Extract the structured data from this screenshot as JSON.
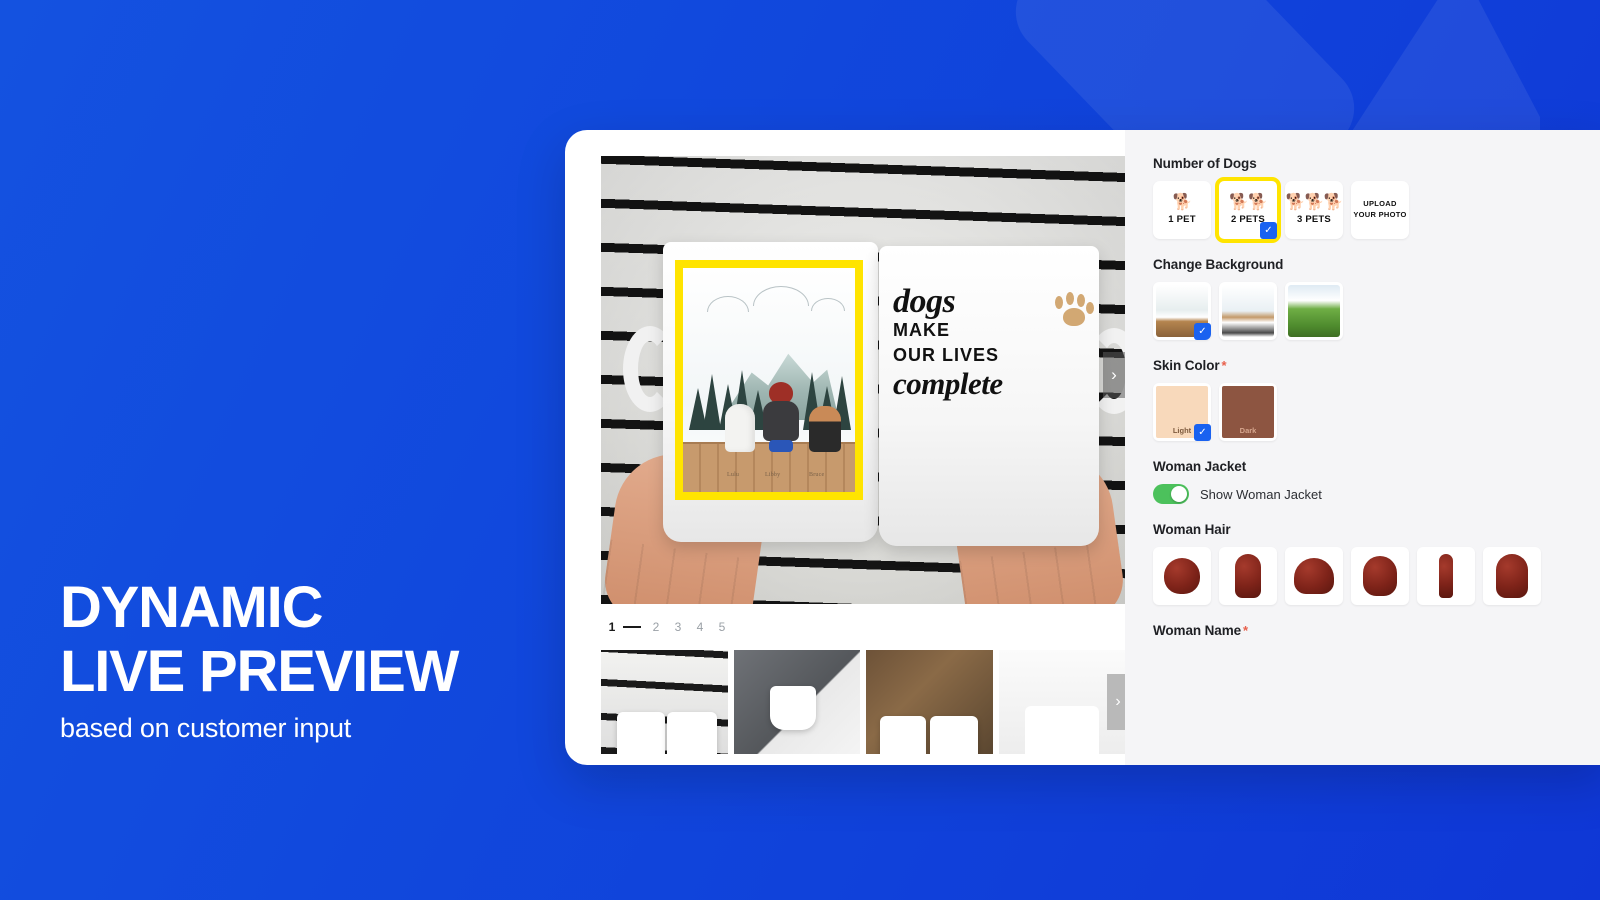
{
  "headline": {
    "line1": "DYNAMIC",
    "line2": "LIVE PREVIEW",
    "subtitle": "based on customer input"
  },
  "theme": {
    "background_blue": "#1149dd",
    "panel_white": "#ffffff",
    "options_bg": "#f5f5f7",
    "selection_yellow": "#ffe400",
    "check_blue": "#1a62f0",
    "toggle_green": "#4CC15C",
    "required_red": "#e8604c"
  },
  "preview": {
    "left_mug": {
      "pet_names": [
        "Lulu",
        "Libby",
        "Bruce"
      ],
      "selected": true
    },
    "right_mug": {
      "quote_line1": "dogs",
      "quote_line2": "MAKE",
      "quote_line3": "OUR  LIVES",
      "quote_line4": "complete"
    },
    "next_arrow": "›",
    "pagination": {
      "pages": [
        "1",
        "2",
        "3",
        "4",
        "5"
      ],
      "active": "1"
    },
    "thumbnails": [
      {
        "name": "thumbnail-1-hands-holding-mugs"
      },
      {
        "name": "thumbnail-2-mug-on-grey-cloth"
      },
      {
        "name": "thumbnail-3-mugs-on-wood"
      },
      {
        "name": "thumbnail-4-single-mug-white"
      }
    ],
    "thumbs_next_arrow": "›"
  },
  "options": {
    "number_of_dogs": {
      "label": "Number of Dogs",
      "required": false,
      "items": [
        {
          "icon": "dog-icon",
          "glyph": "🐕",
          "label": "1 PET",
          "selected": false
        },
        {
          "icon": "two-dogs-icon",
          "glyph": "🐕🐕",
          "label": "2 PETS",
          "selected": true
        },
        {
          "icon": "three-dogs-icon",
          "glyph": "🐕🐕🐕",
          "label": "3 PETS",
          "selected": false
        },
        {
          "icon": "upload-icon",
          "glyph": "",
          "label": "UPLOAD YOUR PHOTO",
          "selected": false
        }
      ]
    },
    "change_background": {
      "label": "Change Background",
      "required": false,
      "items": [
        {
          "name": "background-mountains-forest",
          "selected": true
        },
        {
          "name": "background-lake-pale",
          "selected": false
        },
        {
          "name": "background-green-field",
          "selected": false
        }
      ]
    },
    "skin_color": {
      "label": "Skin Color",
      "required": true,
      "items": [
        {
          "label": "Light",
          "color": "#f8d9bb",
          "selected": true
        },
        {
          "label": "Dark",
          "color": "#8d5541",
          "selected": false
        }
      ]
    },
    "woman_jacket": {
      "label": "Woman Jacket",
      "toggle_label": "Show Woman Jacket",
      "toggle_on": true
    },
    "woman_hair": {
      "label": "Woman Hair",
      "items": [
        {
          "name": "hair-bun",
          "selected": false
        },
        {
          "name": "hair-long-straight",
          "selected": false
        },
        {
          "name": "hair-bob",
          "selected": false
        },
        {
          "name": "hair-wavy-shoulder",
          "selected": false
        },
        {
          "name": "hair-ponytail",
          "selected": false
        },
        {
          "name": "hair-long-curly",
          "selected": false
        }
      ]
    },
    "woman_name": {
      "label": "Woman Name",
      "required": true
    }
  },
  "check_glyph": "✓"
}
